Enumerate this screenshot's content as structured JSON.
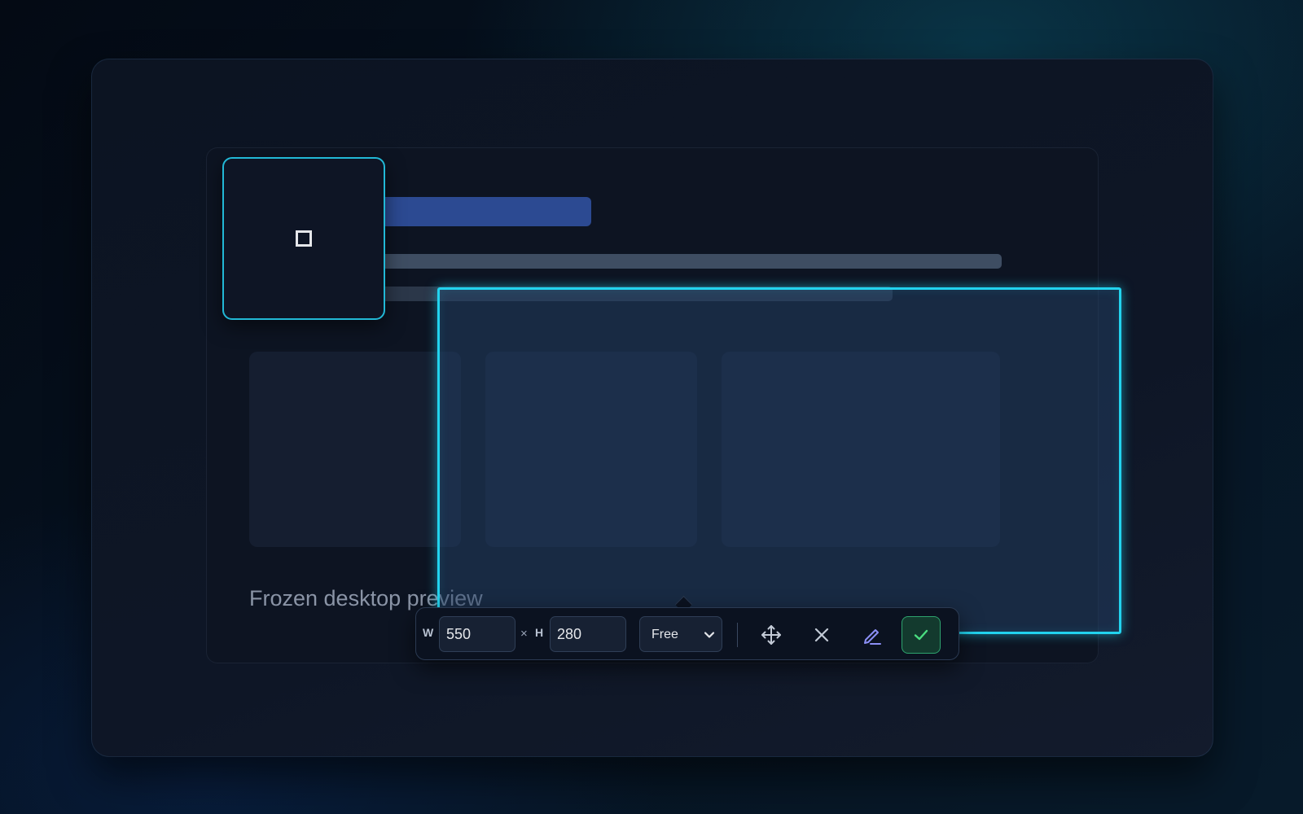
{
  "preview": {
    "caption": "Frozen desktop preview"
  },
  "magnifier": {
    "icon": "square-icon"
  },
  "toolbar": {
    "width_label": "W",
    "width_value": "550",
    "times_symbol": "×",
    "height_label": "H",
    "height_value": "280",
    "aspect_selected": "Free",
    "icons": {
      "move": "move-icon",
      "cancel": "close-icon",
      "annotate": "pen-icon",
      "confirm": "check-icon"
    }
  },
  "colors": {
    "selection_accent": "#22d3ee",
    "confirm_accent": "#2ea36e",
    "mock_titlebar": "#2c4a92"
  }
}
